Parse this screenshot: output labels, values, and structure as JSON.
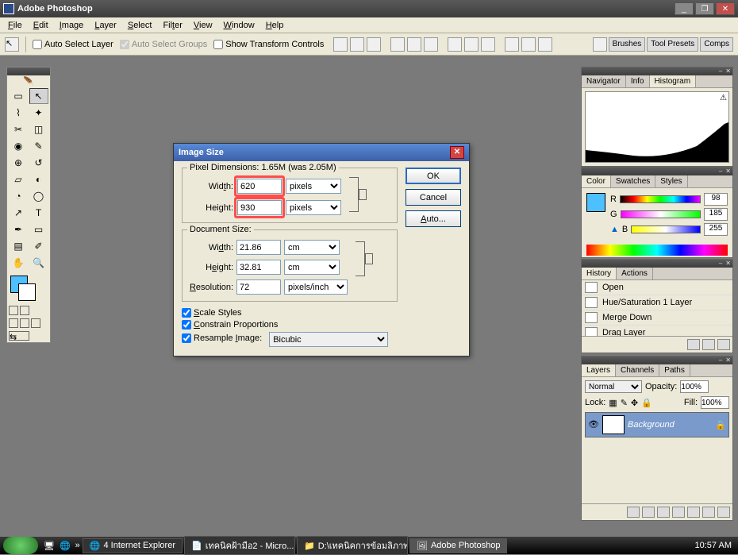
{
  "app": {
    "title": "Adobe Photoshop"
  },
  "menu": [
    "File",
    "Edit",
    "Image",
    "Layer",
    "Select",
    "Filter",
    "View",
    "Window",
    "Help"
  ],
  "opts": {
    "auto_select_layer": "Auto Select Layer",
    "auto_select_groups": "Auto Select Groups",
    "show_transform": "Show Transform Controls",
    "tabs": [
      "Brushes",
      "Tool Presets",
      "Comps"
    ]
  },
  "panels": {
    "nav": {
      "tabs": [
        "Navigator",
        "Info",
        "Histogram"
      ],
      "active": 2
    },
    "color": {
      "tabs": [
        "Color",
        "Swatches",
        "Styles"
      ],
      "active": 0,
      "r_label": "R",
      "g_label": "G",
      "b_label": "B",
      "r": "98",
      "g": "185",
      "b": "255"
    },
    "history": {
      "tabs": [
        "History",
        "Actions"
      ],
      "active": 0,
      "items": [
        "Open",
        "Hue/Saturation 1 Layer",
        "Merge Down",
        "Drag Layer"
      ]
    },
    "layers": {
      "tabs": [
        "Layers",
        "Channels",
        "Paths"
      ],
      "active": 0,
      "blend": "Normal",
      "opacity_label": "Opacity:",
      "opacity": "100%",
      "lock_label": "Lock:",
      "fill_label": "Fill:",
      "fill": "100%",
      "layer_name": "Background"
    }
  },
  "dialog": {
    "title": "Image Size",
    "pixel_legend": "Pixel Dimensions:   1.65M (was 2.05M)",
    "width_label": "Width:",
    "height_label": "Height:",
    "px_width": "620",
    "px_height": "930",
    "px_unit": "pixels",
    "doc_legend": "Document Size:",
    "doc_width": "21.86",
    "doc_height": "32.81",
    "doc_unit": "cm",
    "res_label": "Resolution:",
    "res": "72",
    "res_unit": "pixels/inch",
    "scale_styles": "Scale Styles",
    "constrain": "Constrain Proportions",
    "resample": "Resample Image:",
    "resample_method": "Bicubic",
    "ok": "OK",
    "cancel": "Cancel",
    "auto": "Auto..."
  },
  "taskbar": {
    "items": [
      "4 Internet Explorer",
      "เทคนิคฝ้ามือ2 - Micro...",
      "D:\\เทคนิคการข้อมลิภาพ",
      "Adobe Photoshop"
    ],
    "active": 3,
    "time": "10:57 AM"
  }
}
